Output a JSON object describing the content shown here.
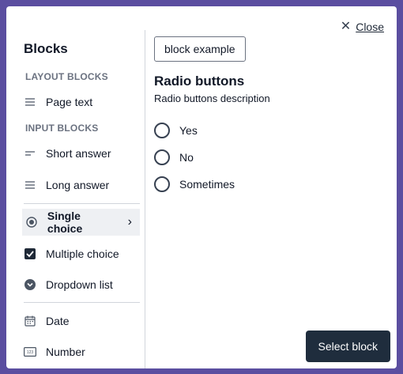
{
  "header": {
    "close_label": "Close"
  },
  "sidebar": {
    "title": "Blocks",
    "sections": [
      {
        "title": "LAYOUT BLOCKS"
      },
      {
        "title": "INPUT BLOCKS"
      }
    ],
    "items": [
      {
        "label": "Page text",
        "icon": "page-text-icon"
      },
      {
        "label": "Short answer",
        "icon": "short-answer-icon"
      },
      {
        "label": "Long answer",
        "icon": "long-answer-icon"
      },
      {
        "label": "Single choice",
        "icon": "radio-selected-icon",
        "selected": true
      },
      {
        "label": "Multiple choice",
        "icon": "checkbox-checked-icon"
      },
      {
        "label": "Dropdown list",
        "icon": "dropdown-icon"
      },
      {
        "label": "Date",
        "icon": "calendar-icon"
      },
      {
        "label": "Number",
        "icon": "number-icon"
      }
    ]
  },
  "main": {
    "example_label": "block example",
    "question_title": "Radio buttons",
    "question_description": "Radio buttons description",
    "options": [
      "Yes",
      "No",
      "Sometimes"
    ],
    "select_label": "Select block"
  }
}
